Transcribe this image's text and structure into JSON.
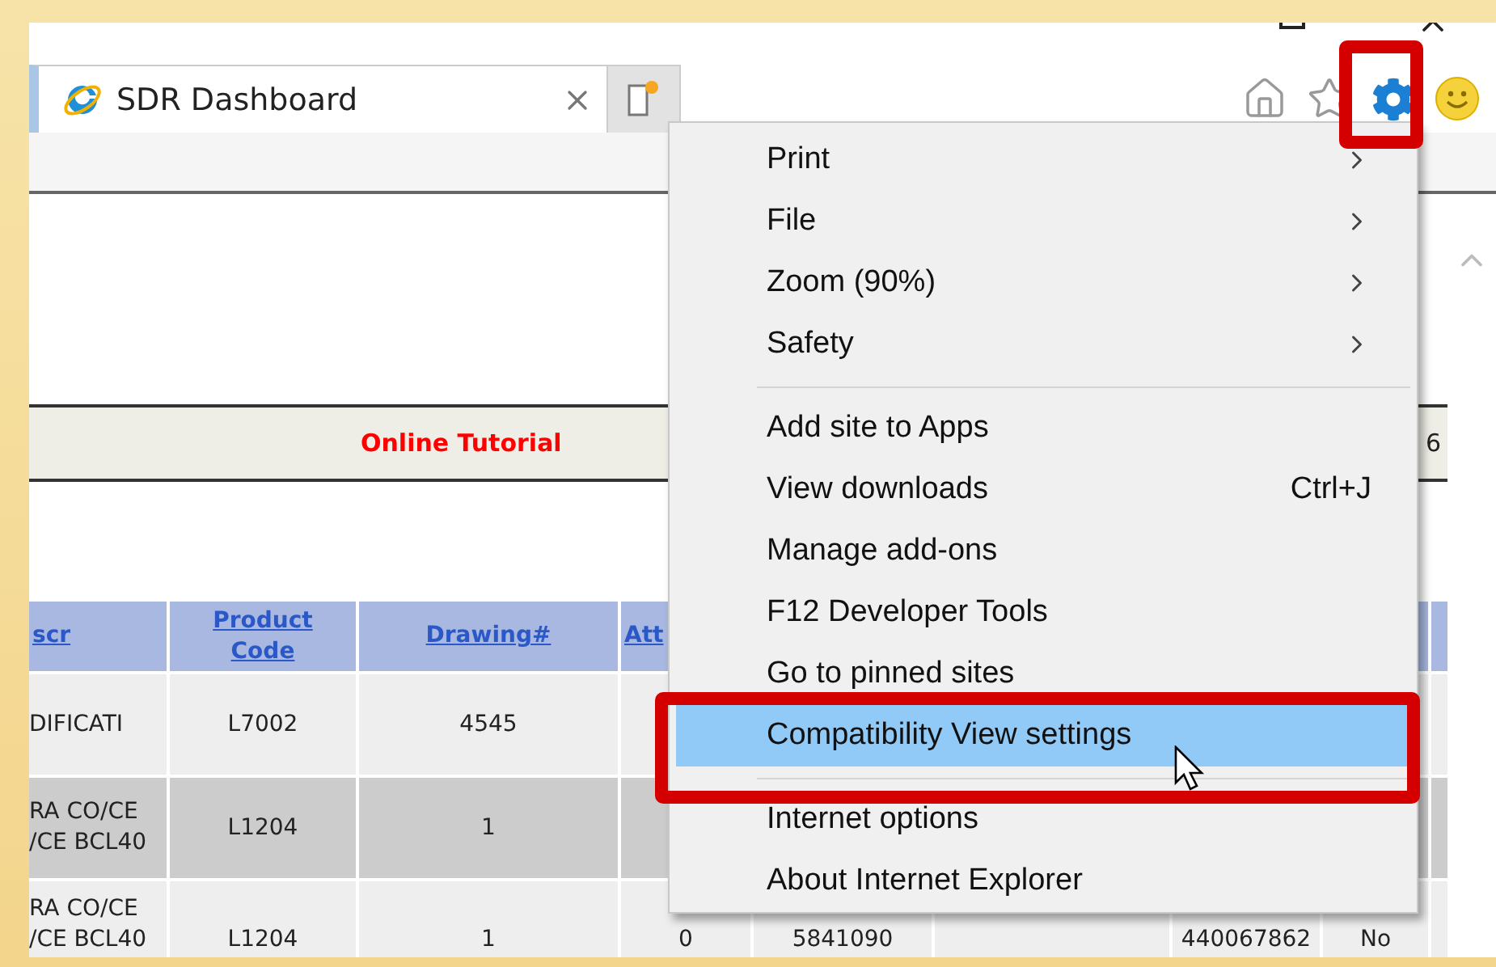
{
  "window": {
    "tab": {
      "title": "SDR Dashboard",
      "selected": true
    }
  },
  "page": {
    "banner": {
      "link": "Online Tutorial",
      "right_text": "6"
    },
    "table": {
      "headers": [
        "scr",
        "Product Code",
        "Drawing#",
        "Att"
      ],
      "rows": [
        {
          "shaded": false,
          "cells": [
            "DIFICATI",
            "L7002",
            "4545"
          ]
        },
        {
          "shaded": true,
          "cells": [
            "RA CO/CE /CE BCL40",
            "L1204",
            "1"
          ]
        },
        {
          "shaded": false,
          "cells": [
            "RA CO/CE /CE BCL40",
            "L1204",
            "1",
            "0",
            "5841090",
            null,
            "440067862",
            "No"
          ]
        }
      ]
    }
  },
  "tools_menu": {
    "items": [
      {
        "kind": "item",
        "label": "Print",
        "submenu": true,
        "selected": false
      },
      {
        "kind": "item",
        "label": "File",
        "submenu": true,
        "selected": false
      },
      {
        "kind": "item",
        "label": "Zoom (90%)",
        "submenu": true,
        "selected": false
      },
      {
        "kind": "item",
        "label": "Safety",
        "submenu": true,
        "selected": false
      },
      {
        "kind": "separator"
      },
      {
        "kind": "item",
        "label": "Add site to Apps",
        "submenu": false,
        "selected": false
      },
      {
        "kind": "item",
        "label": "View downloads",
        "shortcut": "Ctrl+J",
        "submenu": false,
        "selected": false
      },
      {
        "kind": "item",
        "label": "Manage add-ons",
        "submenu": false,
        "selected": false
      },
      {
        "kind": "item",
        "label": "F12 Developer Tools",
        "submenu": false,
        "selected": false
      },
      {
        "kind": "item",
        "label": "Go to pinned sites",
        "submenu": false,
        "selected": false
      },
      {
        "kind": "item",
        "label": "Compatibility View settings",
        "submenu": false,
        "selected": true
      },
      {
        "kind": "separator"
      },
      {
        "kind": "item",
        "label": "Internet options",
        "submenu": false,
        "selected": false
      },
      {
        "kind": "item",
        "label": "About Internet Explorer",
        "submenu": false,
        "selected": false
      }
    ]
  }
}
